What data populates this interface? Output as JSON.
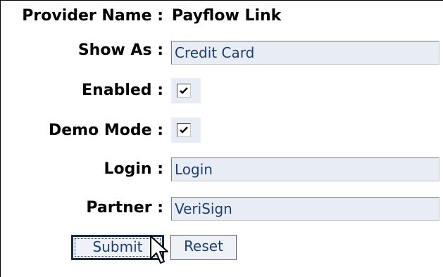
{
  "form": {
    "provider_label": "Provider Name :",
    "provider_value": "Payflow Link",
    "show_as_label": "Show As :",
    "show_as_value": "Credit Card",
    "enabled_label": "Enabled :",
    "enabled_checked": true,
    "demo_mode_label": "Demo Mode :",
    "demo_mode_checked": true,
    "login_label": "Login :",
    "login_value": "Login",
    "partner_label": "Partner :",
    "partner_value": "VeriSign"
  },
  "buttons": {
    "submit_label": "Submit",
    "reset_label": "Reset"
  },
  "colors": {
    "input_bg": "#e8ecf4",
    "input_text": "#1f3e74"
  },
  "icons": {
    "cursor": "mouse-pointer-icon",
    "check": "checkmark-icon"
  }
}
